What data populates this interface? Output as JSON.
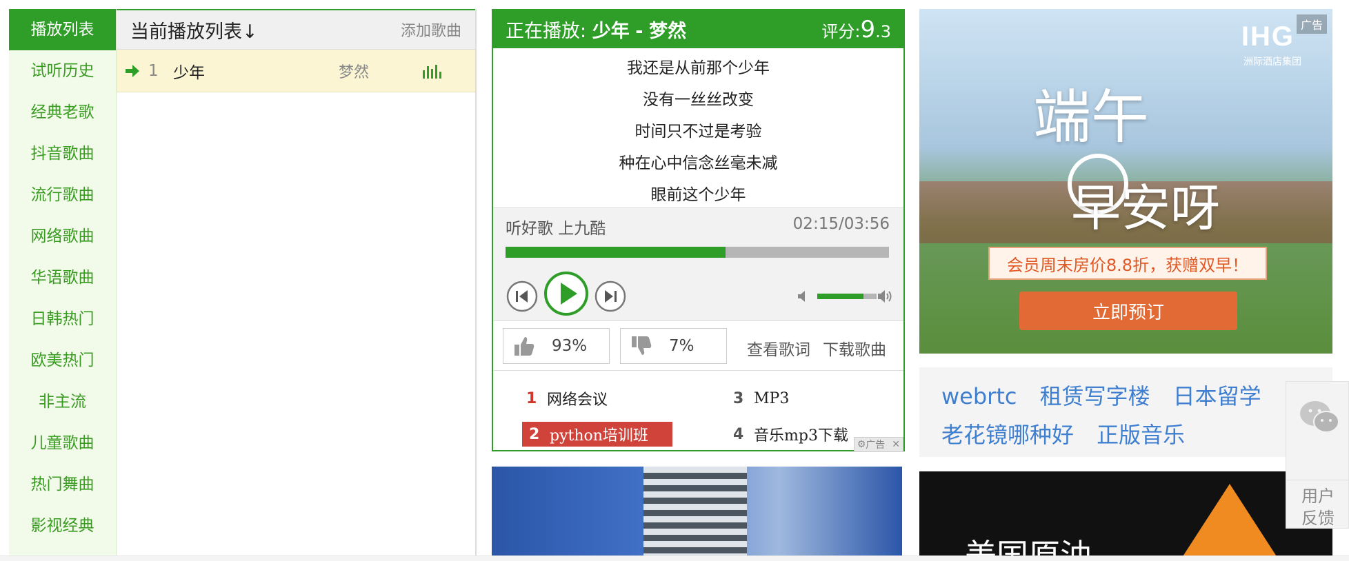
{
  "sidebar": {
    "categories": [
      "播放列表",
      "试听历史",
      "经典老歌",
      "抖音歌曲",
      "流行歌曲",
      "网络歌曲",
      "华语歌曲",
      "日韩热门",
      "欧美热门",
      "非主流",
      "儿童歌曲",
      "热门舞曲",
      "影视经典"
    ],
    "active": "播放列表"
  },
  "playlist": {
    "title": "当前播放列表↓",
    "add_label": "添加歌曲",
    "rows": [
      {
        "num": "1",
        "song": "少年",
        "artist": "梦然"
      }
    ]
  },
  "player": {
    "now_playing_label": "正在播放:",
    "song": "少年",
    "separator": "-",
    "artist": "梦然",
    "score_label": "评分:",
    "score_int": "9",
    "score_dec": ".3",
    "lyrics": [
      "我还是从前那个少年",
      "没有一丝丝改变",
      "时间只不过是考验",
      "种在心中信念丝毫未减",
      "眼前这个少年"
    ],
    "source_text": "听好歌 上九酷",
    "time": "02:15/03:56",
    "progress_fraction": 0.573,
    "volume_fraction": 0.78,
    "like_pct": "93%",
    "dislike_pct": "7%",
    "view_lyrics": "查看歌词",
    "download": "下载歌曲",
    "hot_links": [
      {
        "num": "1",
        "text": "网络会议"
      },
      {
        "num": "2",
        "text": "python培训班"
      },
      {
        "num": "3",
        "text": "MP3"
      },
      {
        "num": "4",
        "text": "音乐mp3下载"
      }
    ],
    "ad_label": "广告",
    "ad_close": "✕"
  },
  "ads": {
    "corner_label": "广告",
    "brand": "IHG",
    "brand_sub": "洲际酒店集团",
    "title": "端午",
    "title2": "早安呀",
    "offer": "会员周末房价8.8折，获赠双早！",
    "book": "立即预订",
    "keywords": [
      "webrtc",
      "租赁写字楼",
      "日本留学",
      "老花镜哪种好",
      "正版音乐"
    ],
    "oil_text": "美国原油"
  },
  "feedback": {
    "label": "用户反馈"
  },
  "colors": {
    "accent": "#2e9e28",
    "link": "#3f7fd0",
    "hot_red": "#d0433a"
  }
}
